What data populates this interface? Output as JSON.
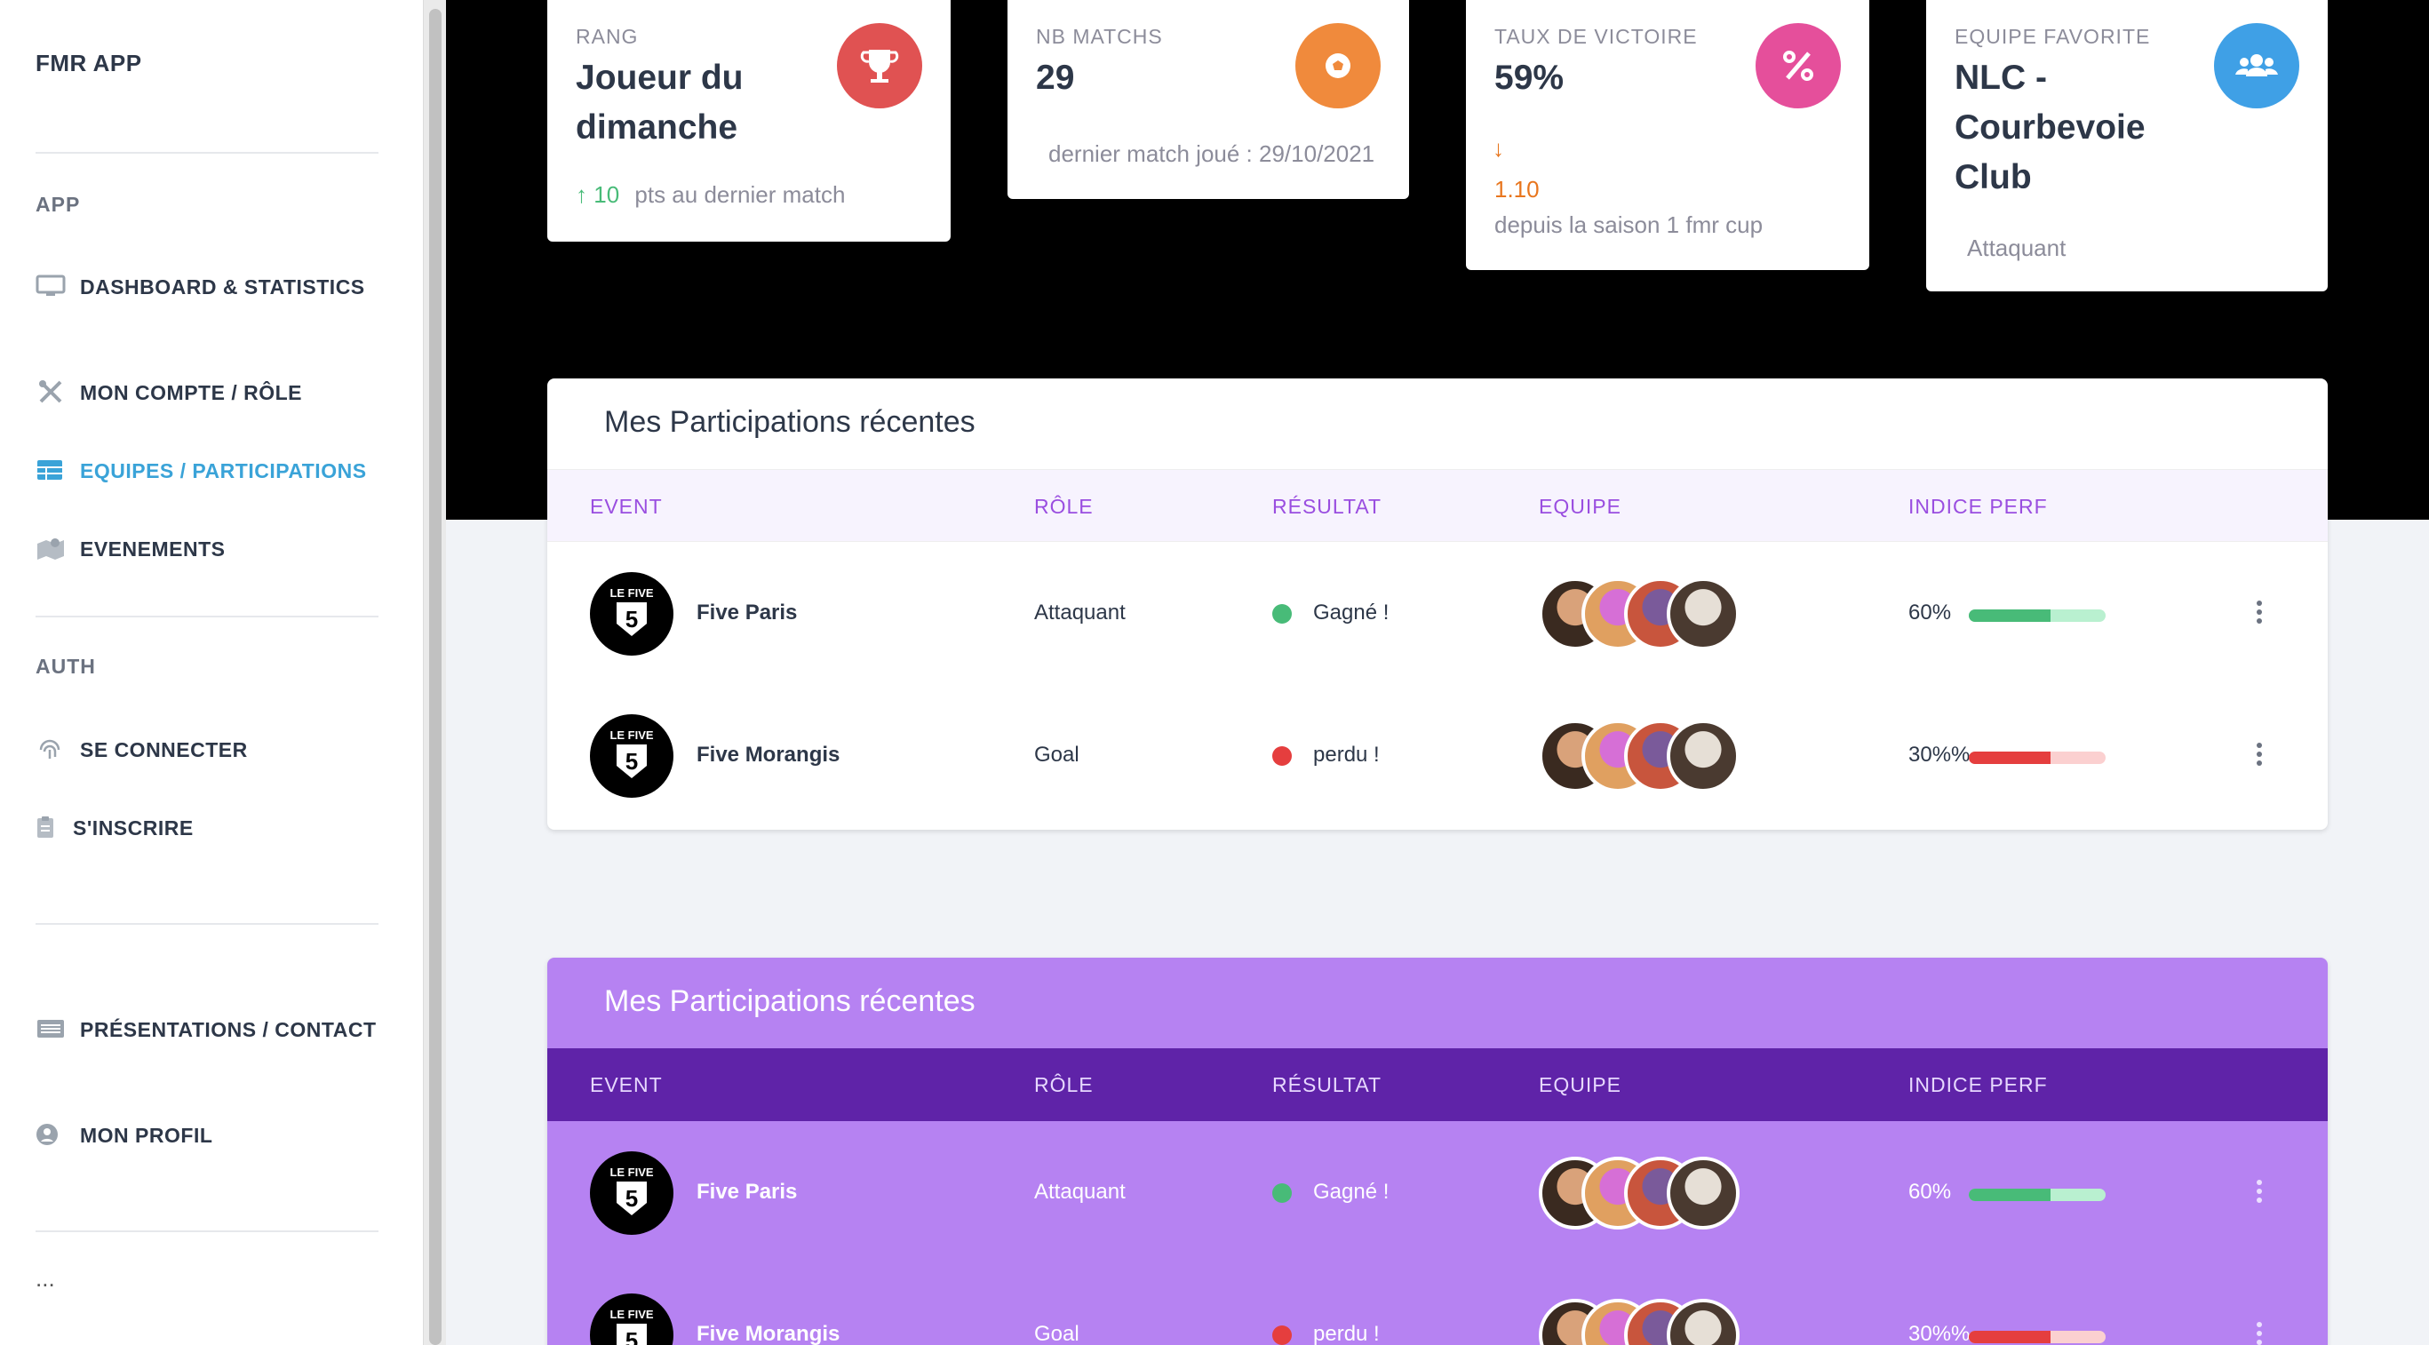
{
  "sidebar": {
    "brand": "FMR APP",
    "sections": {
      "app": "APP",
      "auth": "AUTH"
    },
    "items": {
      "dashboard": "DASHBOARD & STATISTICS",
      "account": "MON COMPTE / RÔLE",
      "teams": "EQUIPES / PARTICIPATIONS",
      "events": "EVENEMENTS",
      "login": "SE CONNECTER",
      "register": "S'INSCRIRE",
      "presentations": "PRÉSENTATIONS / CONTACT",
      "profile": "MON PROFIL"
    },
    "more": "..."
  },
  "stats": [
    {
      "label": "RANG",
      "value": "Joueur du dimanche",
      "trend_value": "10",
      "trend_text": "pts au dernier match",
      "icon": "trophy-icon",
      "color": "#e05252"
    },
    {
      "label": "NB MATCHS",
      "value": "29",
      "note": "dernier match joué : 29/10/2021",
      "icon": "soccer-ball-icon",
      "color": "#f08a3c"
    },
    {
      "label": "TAUX DE VICTOIRE",
      "value": "59%",
      "trend_value": "1.10",
      "trend_text": "depuis la saison 1 fmr cup",
      "icon": "percent-icon",
      "color": "#e54f9b"
    },
    {
      "label": "EQUIPE FAVORITE",
      "value": "NLC - Courbevoie Club",
      "note": "Attaquant",
      "icon": "users-icon",
      "color": "#3fa0e6"
    }
  ],
  "tables": [
    {
      "title": "Mes Participations récentes",
      "columns": [
        "EVENT",
        "RÔLE",
        "RÉSULTAT",
        "EQUIPE",
        "INDICE PERF"
      ],
      "rows": [
        {
          "event": "Five Paris",
          "role": "Attaquant",
          "result": "Gagné !",
          "result_color": "#48bb78",
          "perf": "60%",
          "perf_value": 0.6,
          "perf_color": "#48bb78",
          "perf_track": "#b9f0d0"
        },
        {
          "event": "Five Morangis",
          "role": "Goal",
          "result": "perdu !",
          "result_color": "#e53e3e",
          "perf": "30%%",
          "perf_value": 0.6,
          "perf_color": "#e53e3e",
          "perf_track": "#fbd0d0"
        }
      ]
    },
    {
      "title": "Mes Participations récentes",
      "columns": [
        "EVENT",
        "RÔLE",
        "RÉSULTAT",
        "EQUIPE",
        "INDICE PERF"
      ],
      "rows": [
        {
          "event": "Five Paris",
          "role": "Attaquant",
          "result": "Gagné !",
          "result_color": "#48bb78",
          "perf": "60%",
          "perf_value": 0.6,
          "perf_color": "#48bb78",
          "perf_track": "#b9f0d0"
        },
        {
          "event": "Five Morangis",
          "role": "Goal",
          "result": "perdu !",
          "result_color": "#e53e3e",
          "perf": "30%%",
          "perf_value": 0.6,
          "perf_color": "#e53e3e",
          "perf_track": "#fbd0d0"
        }
      ]
    }
  ],
  "logo_text": {
    "top": "LE FIVE",
    "num": "5"
  }
}
